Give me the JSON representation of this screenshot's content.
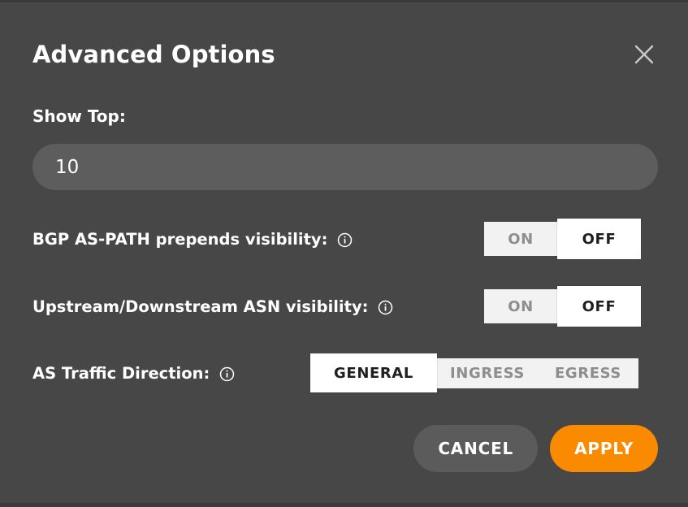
{
  "dialog": {
    "title": "Advanced Options",
    "close_icon": "close-icon"
  },
  "show_top": {
    "label": "Show Top:",
    "value": "10",
    "placeholder": "10"
  },
  "options": [
    {
      "label": "BGP AS-PATH prepends visibility:",
      "info_icon": "info-icon",
      "choices": [
        "ON",
        "OFF"
      ],
      "selected": "OFF"
    },
    {
      "label": "Upstream/Downstream ASN visibility:",
      "info_icon": "info-icon",
      "choices": [
        "ON",
        "OFF"
      ],
      "selected": "OFF"
    }
  ],
  "direction": {
    "label": "AS Traffic Direction:",
    "info_icon": "info-icon",
    "choices": [
      "GENERAL",
      "INGRESS",
      "EGRESS"
    ],
    "selected": "GENERAL"
  },
  "footer": {
    "cancel_label": "CANCEL",
    "apply_label": "APPLY"
  },
  "colors": {
    "dialog_background": "#474747",
    "page_background": "#3b3b3b",
    "input_background": "#5d5d5d",
    "accent": "#fa8b00",
    "cancel_background": "#5b5b5b",
    "segment_selected": "#ffffff",
    "segment_unselected": "#f2f2f2",
    "text_primary": "#ffffff",
    "text_muted": "#8e8e8e"
  }
}
